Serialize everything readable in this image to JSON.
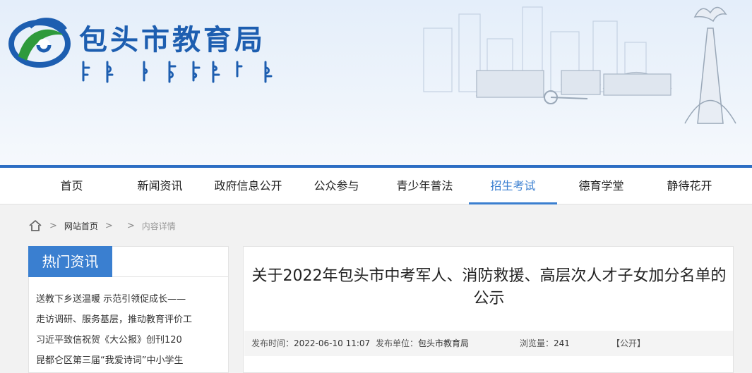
{
  "header": {
    "title": "包头市教育局",
    "mongol_text": "ᠪᠤᠭᠤᠲᠣ ᠬᠣᠲᠠ ᠶᠢᠨ ᠪᠣᠯᠪᠠᠰᠤᠷᠠᠯ",
    "brand_color": "#1d5eb0"
  },
  "nav": {
    "items": [
      {
        "label": "首页"
      },
      {
        "label": "新闻资讯"
      },
      {
        "label": "政府信息公开"
      },
      {
        "label": "公众参与"
      },
      {
        "label": "青少年普法"
      },
      {
        "label": "招生考试"
      },
      {
        "label": "德育学堂"
      },
      {
        "label": "静待花开"
      }
    ],
    "active_index": 5,
    "active_color": "#3a7fd0"
  },
  "breadcrumb": {
    "home_icon": "home-icon",
    "items": [
      {
        "label": "网站首页"
      },
      {
        "label": ""
      },
      {
        "label": "内容详情"
      }
    ],
    "separator": ">"
  },
  "sidebar": {
    "title": "热门资讯",
    "items": [
      {
        "label": "送教下乡送温暖 示范引领促成长——"
      },
      {
        "label": "走访调研、服务基层，推动教育评价工"
      },
      {
        "label": "习近平致信祝贺《大公报》创刊120"
      },
      {
        "label": "昆都仑区第三届“我爱诗词”中小学生"
      }
    ]
  },
  "article": {
    "title": "关于2022年包头市中考军人、消防救援、高层次人才子女加分名单的公示",
    "publish_time_label": "发布时间：",
    "publish_time": "2022-06-10 11:07",
    "publisher_label": "发布单位：",
    "publisher": "包头市教育局",
    "views_label": "浏览量：",
    "views": "241",
    "status": "【公开】"
  }
}
